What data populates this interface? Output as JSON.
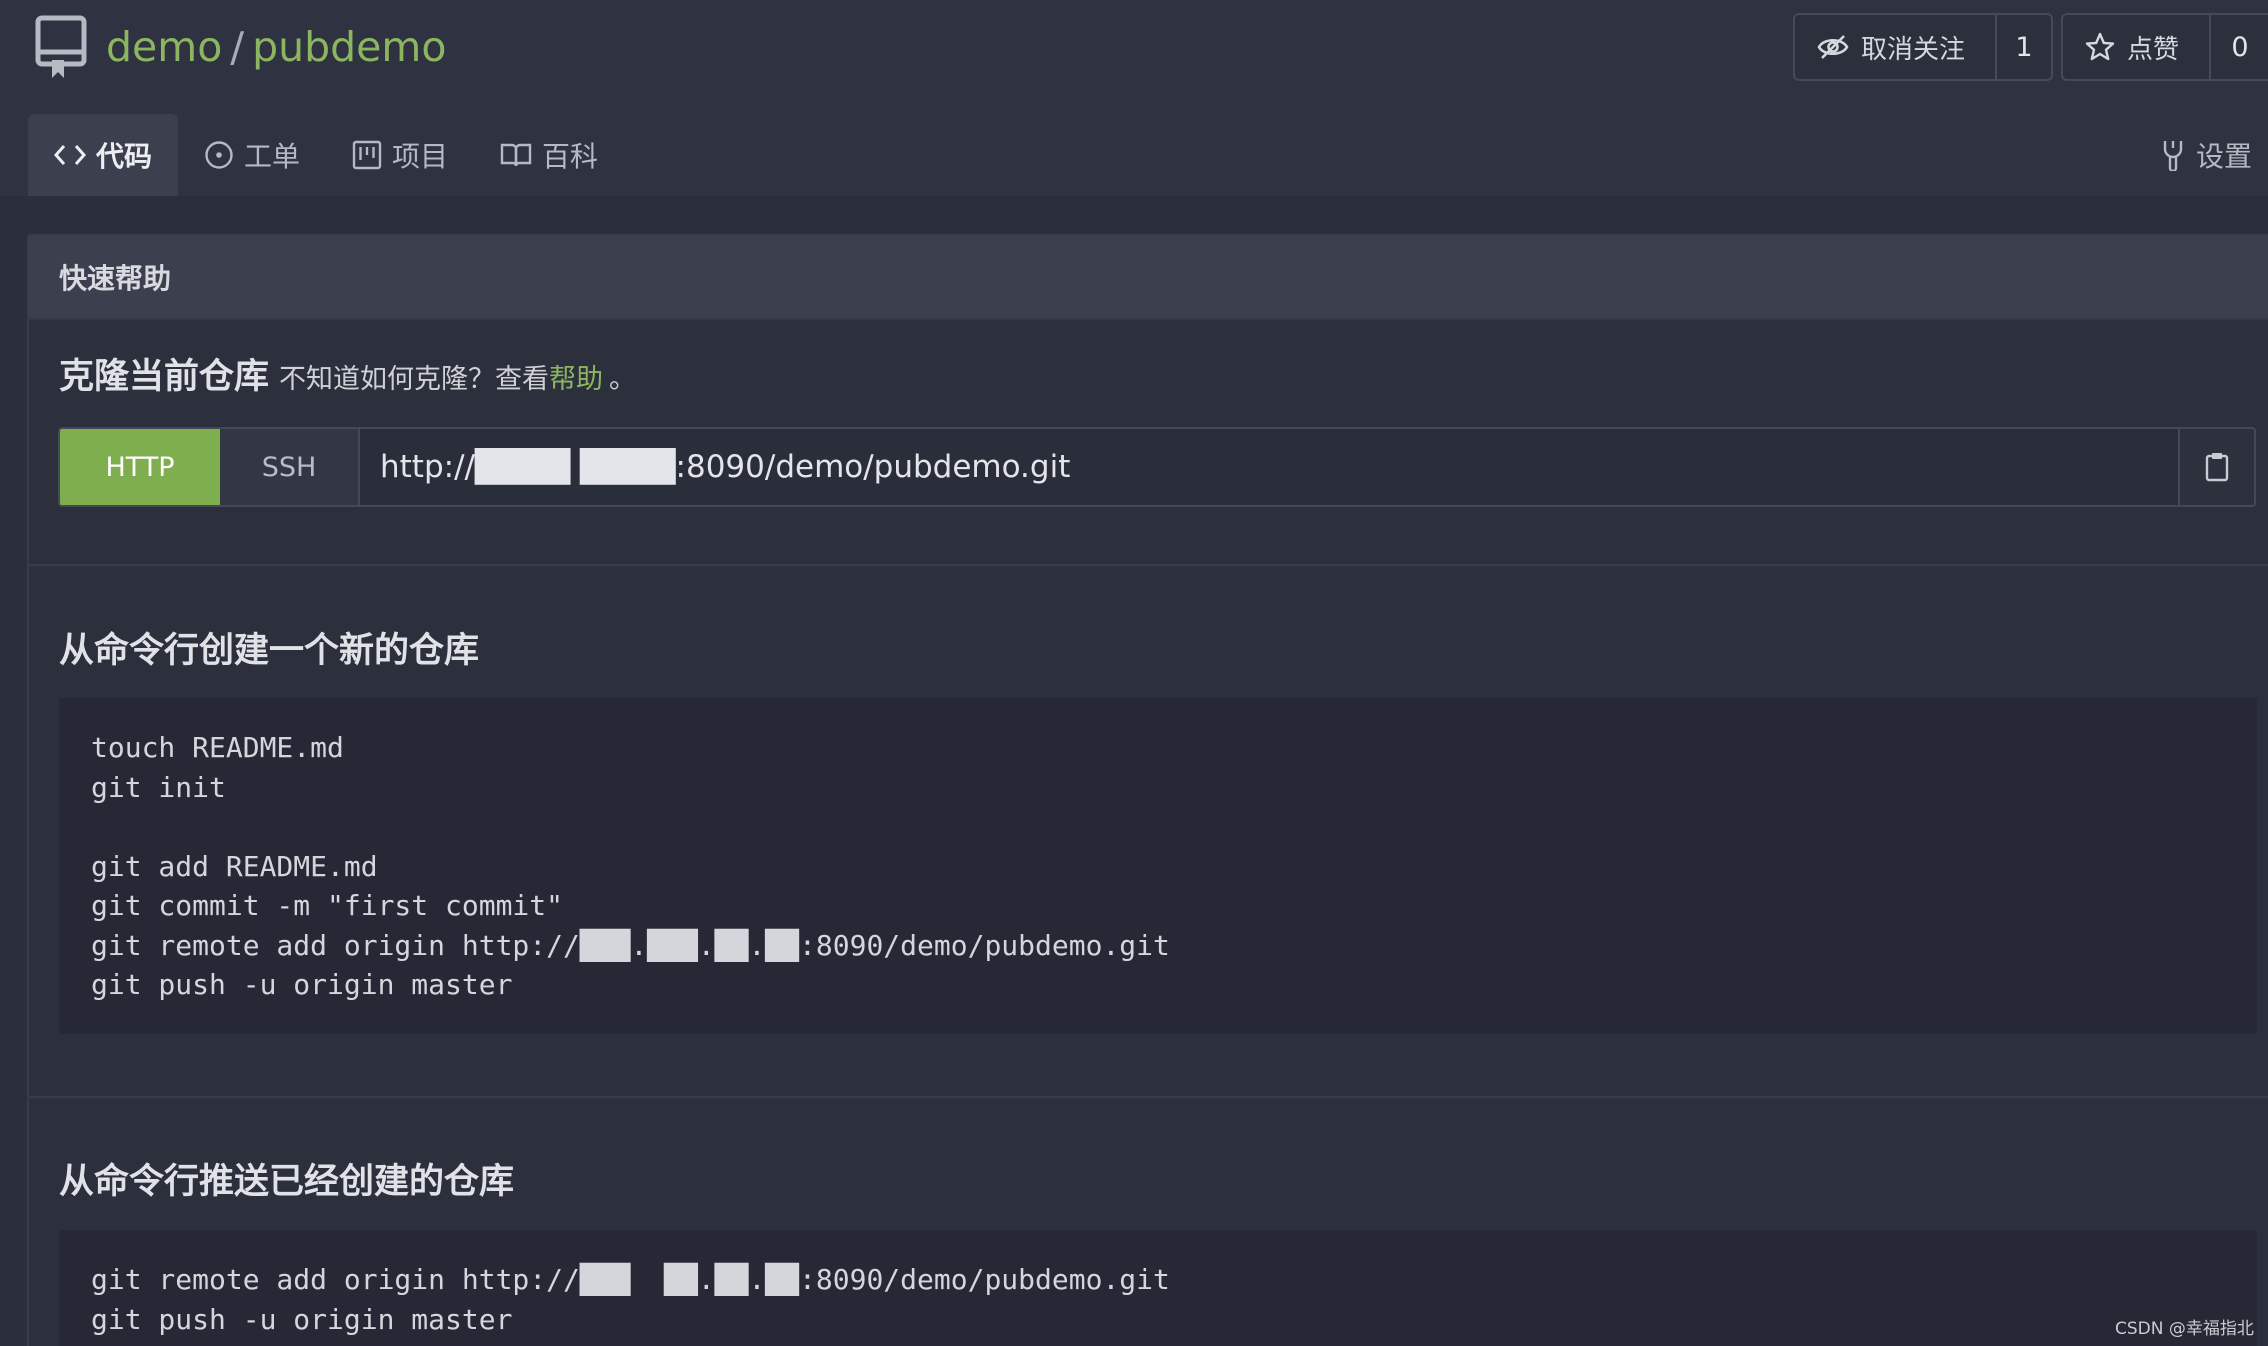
{
  "repo": {
    "owner": "demo",
    "separator": "/",
    "name": "pubdemo"
  },
  "actions": {
    "watch_label": "取消关注",
    "watch_count": "1",
    "star_label": "点赞",
    "star_count": "0"
  },
  "tabs": [
    {
      "label": "代码",
      "icon": "code-icon",
      "active": true
    },
    {
      "label": "工单",
      "icon": "issue-icon",
      "active": false
    },
    {
      "label": "项目",
      "icon": "project-icon",
      "active": false
    },
    {
      "label": "百科",
      "icon": "book-icon",
      "active": false
    }
  ],
  "settings_label": "设置",
  "quick_help": {
    "title": "快速帮助",
    "clone_heading": "克隆当前仓库",
    "clone_question": "不知道如何克隆？查看",
    "help_link": "帮助",
    "clone_tail": "。",
    "protocols": {
      "http": "HTTP",
      "ssh": "SSH"
    },
    "clone_url": "http://████  ████:8090/demo/pubdemo.git"
  },
  "sections": {
    "new_repo": {
      "title": "从命令行创建一个新的仓库",
      "lines": [
        "touch README.md",
        "git init",
        "",
        "git add README.md",
        "git commit -m \"first commit\"",
        "git remote add origin http://███.███.██.██:8090/demo/pubdemo.git",
        "git push -u origin master"
      ]
    },
    "existing_repo": {
      "title": "从命令行推送已经创建的仓库",
      "lines": [
        "git remote add origin http://███  ██.██.██:8090/demo/pubdemo.git",
        "git push -u origin master"
      ]
    }
  },
  "watermark": "CSDN @幸福指北",
  "colors": {
    "accent": "#8bb55f",
    "http_button": "#7fae4f",
    "background": "#2b2e3b"
  }
}
